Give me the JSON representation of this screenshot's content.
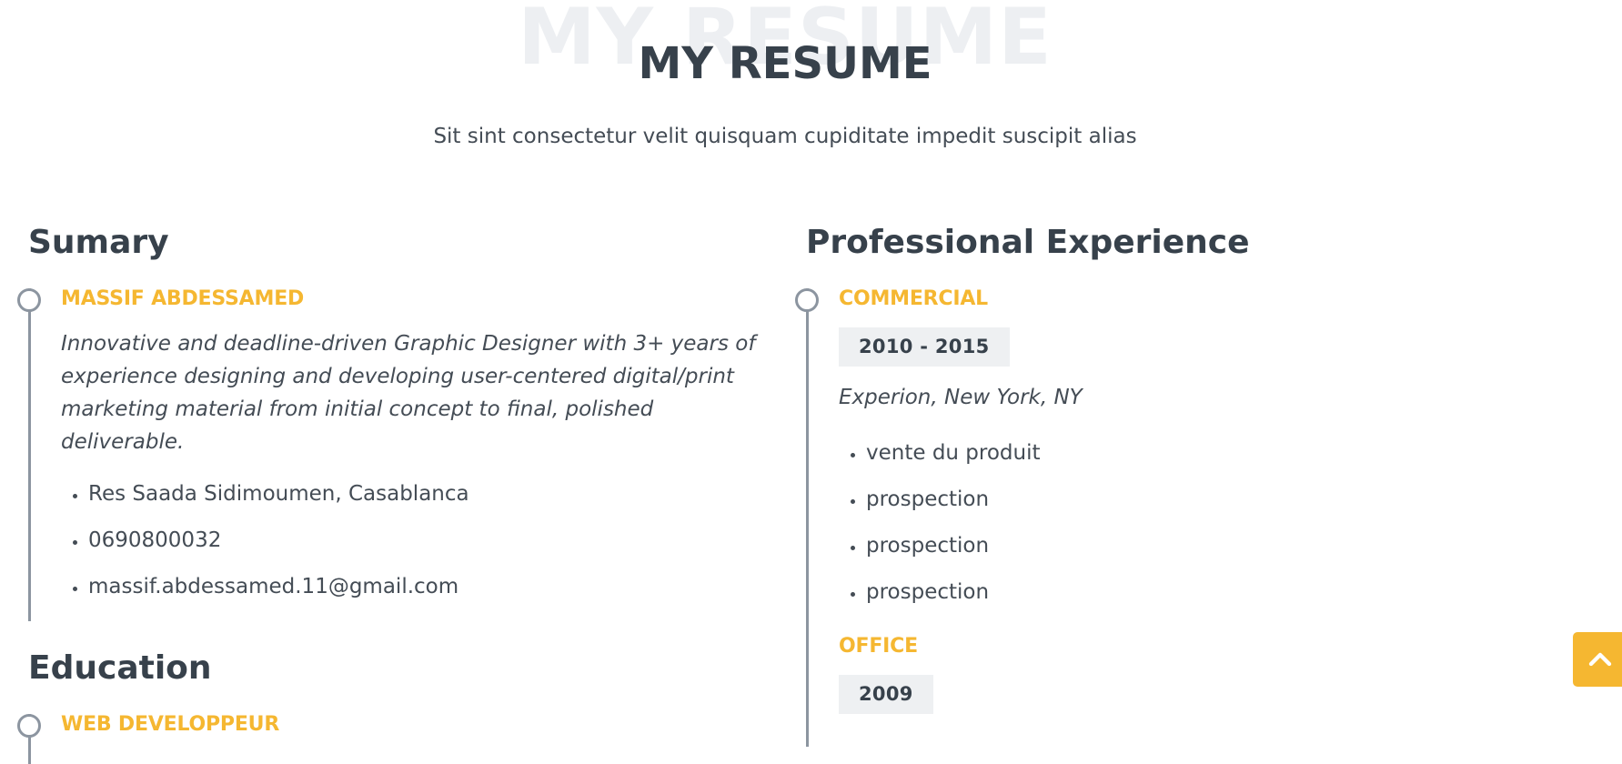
{
  "header": {
    "title_bg": "MY RESUME",
    "title": "MY RESUME",
    "subtitle": "Sit sint consectetur velit quisquam cupiditate impedit suscipit alias"
  },
  "summary": {
    "heading": "Sumary",
    "name": "MASSIF ABDESSAMED",
    "description": "Innovative and deadline-driven Graphic Designer with 3+ years of experience designing and developing user-centered digital/print marketing material from initial concept to final, polished deliverable.",
    "contacts": [
      "Res Saada Sidimoumen, Casablanca",
      "0690800032",
      "massif.abdessamed.11@gmail.com"
    ]
  },
  "education": {
    "heading": "Education",
    "items": [
      {
        "title": "WEB DEVELOPPEUR"
      }
    ]
  },
  "experience": {
    "heading": "Professional Experience",
    "items": [
      {
        "title": "COMMERCIAL",
        "years": "2010 - 2015",
        "place": "Experion, New York, NY",
        "tasks": [
          "vente du produit",
          "prospection",
          "prospection",
          "prospection"
        ]
      },
      {
        "title": "OFFICE",
        "years": "2009"
      }
    ]
  },
  "back_to_top": {
    "icon": "chevron-up-icon"
  },
  "colors": {
    "accent": "#f5b731",
    "heading": "#37414b",
    "timeline": "#8c95a0",
    "year_bg": "#eef0f2"
  }
}
